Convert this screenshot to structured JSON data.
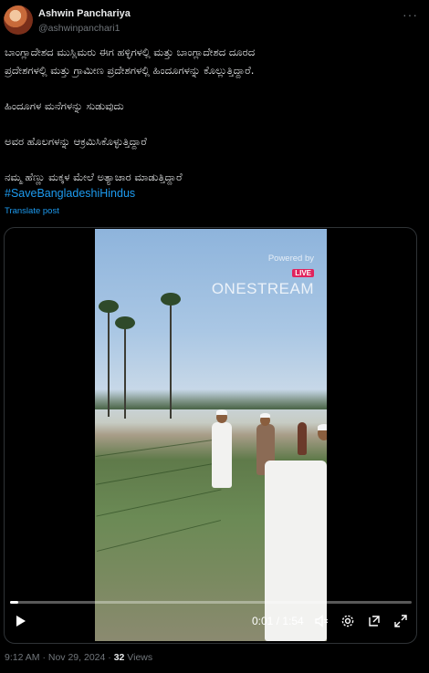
{
  "author": {
    "name": "Ashwin Panchariya",
    "handle": "@ashwinpanchari1"
  },
  "header": {
    "more_label": "···"
  },
  "post": {
    "lines": [
      "ಬಾಂಗ್ಲಾದೇಶದ ಮುಸ್ಲಿಮರು ಈಗ ಹಳ್ಳಿಗಳಲ್ಲಿ  ಮತ್ತು ಬಾಂಗ್ಲಾದೇಶದ ದೂರದ",
      "ಪ್ರದೇಶಗಳಲ್ಲಿ ಮತ್ತು ಗ್ರಾಮೀಣ ಪ್ರದೇಶಗಳಲ್ಲಿ ಹಿಂದೂಗಳನ್ನು ಕೊಲ್ಲುತ್ತಿದ್ದಾರೆ.",
      "ಹಿಂದೂಗಳ ಮನೆಗಳನ್ನು ಸುಡುವುದು",
      "ಅವರ ಹೊಲಗಳನ್ನು ಆಕ್ರಮಿಸಿಕೊಳ್ಳುತ್ತಿದ್ದಾರೆ",
      " ನಮ್ಮ ಹೆಣ್ಣು ಮಕ್ಕಳ ಮೇಲೆ ಅತ್ಯಾಚಾರ ಮಾಡುತ್ತಿದ್ದಾರೆ"
    ],
    "hashtag": "#SaveBangladeshiHindus",
    "translate_label": "Translate post"
  },
  "video": {
    "watermark_powered": "Powered by",
    "watermark_live": "LIVE",
    "watermark_brand": "ONESTREAM",
    "time_display": "0:01 / 1:54",
    "progress_fraction": 0.009
  },
  "controls": {
    "play_icon": "play-icon",
    "volume_icon": "volume-icon",
    "settings_icon": "settings-icon",
    "popout_icon": "popout-icon",
    "fullscreen_icon": "fullscreen-icon"
  },
  "footer": {
    "time": "9:12 AM",
    "sep": " · ",
    "date": "Nov 29, 2024",
    "views_count": "32",
    "views_label": " Views"
  },
  "colors": {
    "link": "#1d9bf0",
    "muted": "#71767b",
    "text": "#e7e9ea"
  }
}
